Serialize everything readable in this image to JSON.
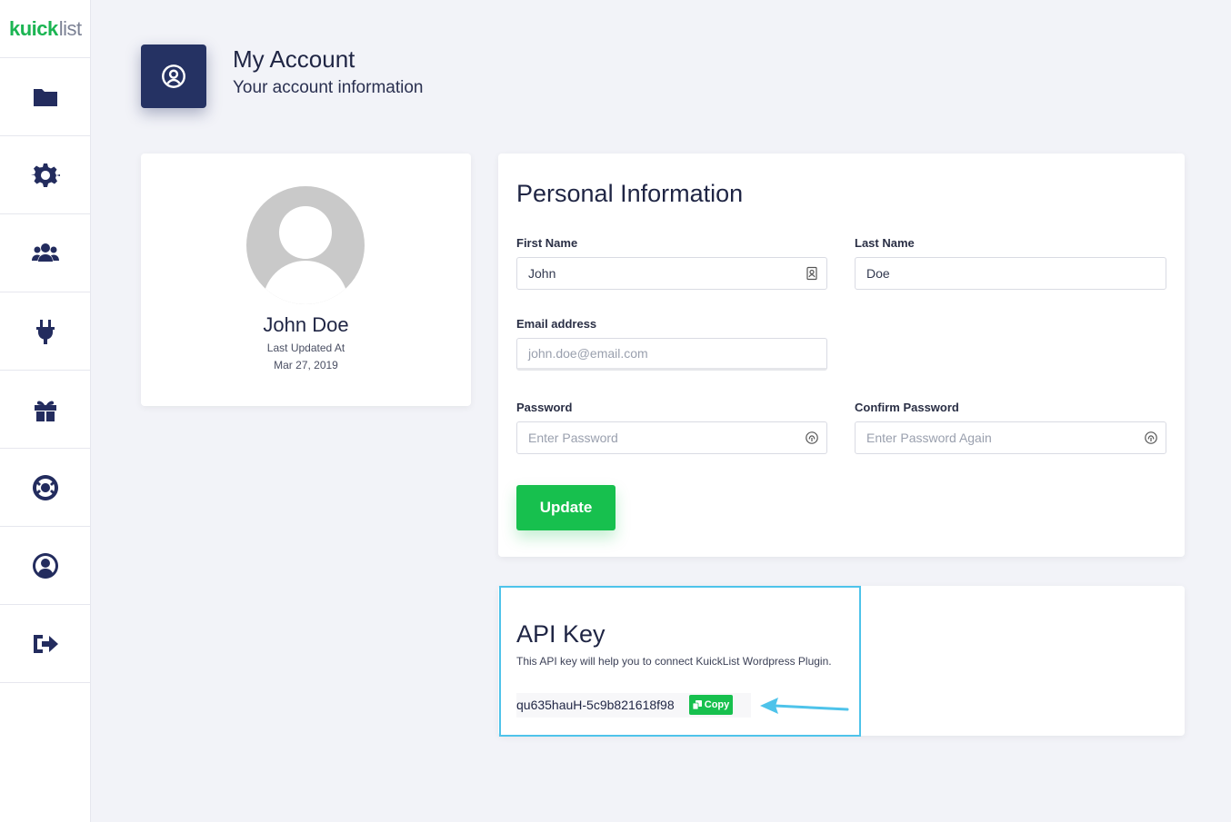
{
  "brand": {
    "logo_bold": "kuick",
    "logo_light": "list"
  },
  "sidebar": {
    "items": [
      {
        "icon": "folder-icon"
      },
      {
        "icon": "gear-icon"
      },
      {
        "icon": "users-icon"
      },
      {
        "icon": "plug-icon"
      },
      {
        "icon": "gift-icon"
      },
      {
        "icon": "lifebuoy-icon"
      },
      {
        "icon": "user-circle-icon"
      },
      {
        "icon": "sign-out-icon"
      }
    ],
    "icon_color": "#232c5e"
  },
  "header": {
    "title": "My Account",
    "subtitle": "Your account information",
    "icon": "user-circle-icon"
  },
  "profile": {
    "name": "John Doe",
    "updated_label": "Last Updated At",
    "updated_date": "Mar 27, 2019"
  },
  "personal_info": {
    "title": "Personal Information",
    "first_name": {
      "label": "First Name",
      "value": "John"
    },
    "last_name": {
      "label": "Last Name",
      "value": "Doe"
    },
    "email": {
      "label": "Email address",
      "placeholder": "john.doe@email.com"
    },
    "password": {
      "label": "Password",
      "placeholder": "Enter Password"
    },
    "confirm_password": {
      "label": "Confirm Password",
      "placeholder": "Enter Password Again"
    },
    "update_label": "Update"
  },
  "api": {
    "title": "API Key",
    "description": "This API key will help you to connect KuickList Wordpress Plugin.",
    "key": "qu635hauH-5c9b821618f98",
    "copy_label": "Copy"
  },
  "colors": {
    "primary": "#253263",
    "accent_green": "#17c04e",
    "highlight": "#4ec3ea",
    "background": "#f2f3f8"
  }
}
